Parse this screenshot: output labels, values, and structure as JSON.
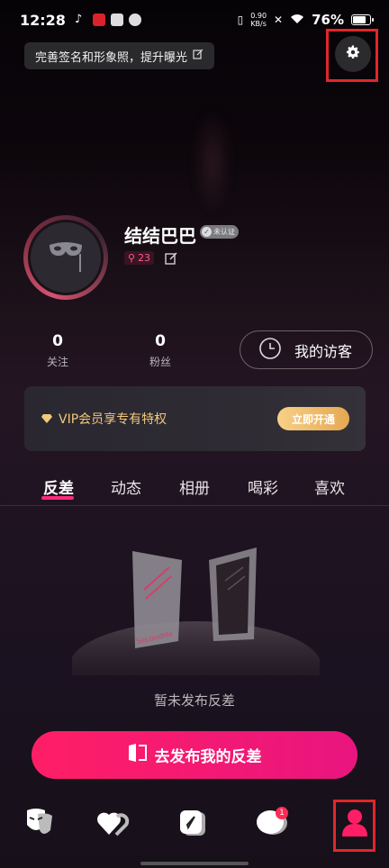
{
  "status_bar": {
    "time": "12:28",
    "net_speed": "0.90\nKB/s",
    "battery": "76%",
    "battery_level": 0.76
  },
  "profile_tip": "完善签名和形象照，提升曝光",
  "profile": {
    "username": "结结巴巴",
    "verify_badge": "未认证",
    "level": "23"
  },
  "stats": [
    {
      "value": "0",
      "label": "关注"
    },
    {
      "value": "0",
      "label": "粉丝"
    }
  ],
  "visitors_button": "我的访客",
  "vip": {
    "label": "VIP会员享专有特权",
    "button": "立即开通"
  },
  "tabs": [
    "反差",
    "动态",
    "相册",
    "喝彩",
    "喜欢"
  ],
  "active_tab": "反差",
  "empty_state": {
    "illustration_text": "SecondMe",
    "message": "暂未发布反差"
  },
  "publish_button": "去发布我的反差",
  "bottom_nav": {
    "items": [
      "mask-icon",
      "heart-icon",
      "compass-icon",
      "chat-icon",
      "profile-icon"
    ],
    "chat_badge": "1"
  },
  "colors": {
    "accent": "#ff1e66",
    "gold": "#f2c97a",
    "highlight": "#e0272b"
  }
}
